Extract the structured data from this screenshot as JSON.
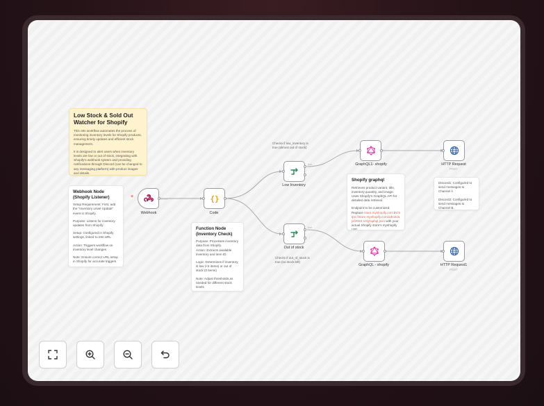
{
  "sticky_main": {
    "title": "Low Stock & Sold Out Watcher for Shopify",
    "p1": "This n8n workflow automates the process of monitoring inventory levels for Shopify products, ensuring timely updates and efficient stock management.",
    "p2": "It is designed to alert users when inventory levels are low or out of stock, integrating with Shopify's webhook system and providing notifications through Discord (can be changed to any messaging platform) with product images and details."
  },
  "sticky_webhook": {
    "title": "Webhook Node (Shopify Listener)",
    "p1": "Setup Requirement: First, add the \"Inventory Level Update\" event in Shopify.",
    "p2": "Purpose: Listens for inventory updates from Shopify.",
    "p3": "Setup: Configured in Shopify settings, linked to n8n URL",
    "p4": "Action: Triggers workflow on inventory level changes",
    "p5": "Note: Ensure correct URL setup in Shopify for accurate triggers"
  },
  "sticky_function": {
    "title": "Function Node (Inventory Check)",
    "p1": "Purpose: Processes inventory data from Shopify.\nAction: Extracts available inventory and item ID.",
    "p2": "Logic: Determines if inventory is low (<4 items) or out of stock (0 items)",
    "p3": "Note: Adjust thresholds as needed for different stock levels"
  },
  "sticky_graphql": {
    "title": "Shopify graphql",
    "p1": "Retrieves product variant, title, inventory quantity, and image. Uses Shopify's GraphQL API for detailed data retrieval.",
    "p2a": "Endpoint to be customized: Replace ",
    "p2link1": "store.myshopify.com",
    "p2b": " in ",
    "p2link2": "https://store.myshopify.com/admin/api/2023-10/graphql.json",
    "p2c": " with your actual Shopify store's myshopify URL"
  },
  "sticky_discord": {
    "p1": "Discord1: Configured to send messages to Channel A",
    "p2": "Discord2: Configured to send messages to Channel B."
  },
  "notes": {
    "low_check": "Checks if low_inventory is true (almost out of stock)",
    "out_check": "Checks if out_of_stock is true (no stock left)"
  },
  "nodes": {
    "webhook": {
      "label": "Webhook",
      "port_label": "POST"
    },
    "code": {
      "label": "Code"
    },
    "low_inventory": {
      "label": "Low Inventory"
    },
    "out_of_stock": {
      "label": "Out of stock"
    },
    "graphql1": {
      "label": "GraphQL1- shopify"
    },
    "graphql2": {
      "label": "GraphQL - shopify"
    },
    "http1": {
      "label": "HTTP Request",
      "sub": "POST"
    },
    "http2": {
      "label": "HTTP Request1",
      "sub": "POST"
    }
  },
  "controls": [
    "fit-view",
    "zoom-in",
    "zoom-out",
    "undo"
  ],
  "colors": {
    "accent": "#e0664a",
    "switch": "#2e8b57",
    "graphql": "#e535ab",
    "http": "#2f5fa8",
    "code": "#f0a020"
  }
}
